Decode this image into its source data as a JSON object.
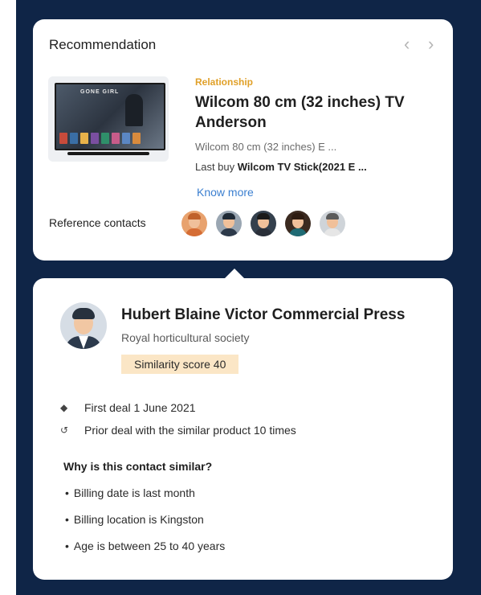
{
  "recommendation": {
    "title": "Recommendation",
    "prev_icon": "chevron-left-icon",
    "next_icon": "chevron-right-icon",
    "tag": "Relationship",
    "product_name": "Wilcom 80 cm (32 inches) TV Anderson",
    "product_desc": "Wilcom 80 cm (32 inches) E ...",
    "last_buy_label": "Last buy",
    "last_buy_value": "Wilcom TV Stick(2021 E ...",
    "know_more": "Know more",
    "thumb_banner": "GONE GIRL",
    "reference_label": "Reference contacts",
    "reference_avatars": [
      {
        "hair": "#c0612b",
        "body": "#d56d35",
        "bg": "#e8a26e"
      },
      {
        "hair": "#1f2a36",
        "body": "#2d3a4a",
        "bg": "#9aa6b2"
      },
      {
        "hair": "#1a1a1a",
        "body": "#2a2f39",
        "bg": "#34404d"
      },
      {
        "hair": "#2e1c12",
        "body": "#1f6b74",
        "bg": "#3b2a20"
      },
      {
        "hair": "#5b5b5b",
        "body": "#e6e6e6",
        "bg": "#cfd4d9"
      }
    ]
  },
  "contact": {
    "name": "Hubert Blaine Victor Commercial Press",
    "org": "Royal horticultural society",
    "similarity": "Similarity score 40",
    "facts": [
      {
        "icon": "diamond-icon",
        "text": "First deal 1 June 2021"
      },
      {
        "icon": "history-icon",
        "text": "Prior deal with the similar product 10 times"
      }
    ],
    "why_title": "Why is this contact similar?",
    "reasons": [
      "Billing date is last month",
      "Billing location is Kingston",
      "Age is between 25 to 40 years"
    ]
  },
  "colors": {
    "background": "#0f2547",
    "tag": "#e0a028",
    "link": "#3b7fd0",
    "badge": "#fbe6c6"
  }
}
